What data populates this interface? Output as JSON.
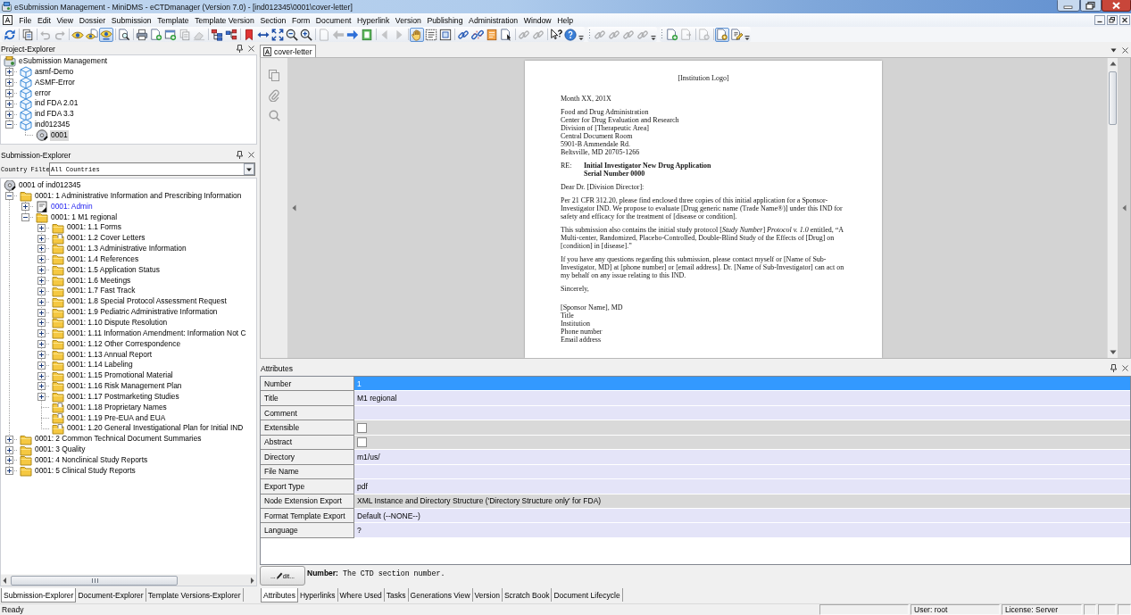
{
  "window": {
    "title": "eSubmission Management - MiniDMS - eCTDmanager (Version 7.0) - [ind012345\\0001\\cover-letter]"
  },
  "menu": [
    "File",
    "Edit",
    "View",
    "Dossier",
    "Submission",
    "Template",
    "Template Version",
    "Section",
    "Form",
    "Document",
    "Hyperlink",
    "Version",
    "Publishing",
    "Administration",
    "Window",
    "Help"
  ],
  "toolbars": [
    {
      "groups": [
        [
          {
            "pressed": false,
            "disabled": false
          }
        ],
        [
          {
            "pressed": false,
            "disabled": false
          }
        ],
        [
          {
            "pressed": false,
            "disabled": true
          },
          {
            "pressed": false,
            "disabled": true
          }
        ],
        [
          {
            "pressed": false,
            "disabled": false
          },
          {
            "pressed": false,
            "disabled": false
          },
          {
            "pressed": true,
            "disabled": false
          }
        ],
        [
          {
            "pressed": false,
            "disabled": false
          }
        ],
        [
          {
            "pressed": false,
            "disabled": false
          },
          {
            "pressed": false,
            "disabled": false
          },
          {
            "pressed": false,
            "disabled": false
          },
          {
            "pressed": false,
            "disabled": true
          },
          {
            "pressed": false,
            "disabled": true
          }
        ],
        [
          {
            "pressed": false,
            "disabled": false
          },
          {
            "pressed": false,
            "disabled": false
          }
        ],
        [
          {
            "pressed": false,
            "disabled": false
          },
          {
            "pressed": false,
            "disabled": false
          },
          {
            "pressed": false,
            "disabled": false
          },
          {
            "pressed": false,
            "disabled": false
          },
          {
            "pressed": false,
            "disabled": false
          }
        ],
        [
          {
            "pressed": false,
            "disabled": true
          },
          {
            "pressed": false,
            "disabled": true
          },
          {
            "pressed": false,
            "disabled": false
          },
          {
            "pressed": false,
            "disabled": false
          }
        ],
        [
          {
            "pressed": false,
            "disabled": true
          },
          {
            "pressed": false,
            "disabled": true
          }
        ],
        [
          {
            "pressed": true,
            "disabled": false
          },
          {
            "pressed": false,
            "disabled": false
          },
          {
            "pressed": false,
            "disabled": false
          }
        ],
        [
          {
            "pressed": false,
            "disabled": false
          },
          {
            "pressed": false,
            "disabled": false
          },
          {
            "pressed": false,
            "disabled": false
          },
          {
            "pressed": false,
            "disabled": false
          }
        ],
        [
          {
            "pressed": false,
            "disabled": true
          },
          {
            "pressed": false,
            "disabled": true
          }
        ],
        [
          {
            "pressed": false,
            "disabled": false
          },
          {
            "pressed": false,
            "disabled": false
          }
        ]
      ]
    },
    {
      "groups": [
        [
          {
            "pressed": false,
            "disabled": true
          },
          {
            "pressed": false,
            "disabled": true
          },
          {
            "pressed": false,
            "disabled": true
          },
          {
            "pressed": false,
            "disabled": true
          }
        ]
      ]
    },
    {
      "groups": [
        [
          {
            "pressed": false,
            "disabled": false
          },
          {
            "pressed": false,
            "disabled": true
          }
        ],
        [
          {
            "pressed": false,
            "disabled": true
          }
        ],
        [
          {
            "pressed": true,
            "disabled": false
          },
          {
            "pressed": false,
            "disabled": false
          }
        ]
      ]
    }
  ],
  "project_explorer": {
    "title": "Project-Explorer",
    "tree": [
      {
        "label": "eSubmission Management",
        "kind": "project",
        "selected": false,
        "children": [
          {
            "label": "asmf-Demo",
            "kind": "dossier",
            "expanded": false,
            "selected": false
          },
          {
            "label": "ASMF-Error",
            "kind": "dossier",
            "expanded": false,
            "selected": false
          },
          {
            "label": "error",
            "kind": "dossier",
            "expanded": false,
            "selected": false
          },
          {
            "label": "ind FDA 2.01",
            "kind": "dossier",
            "expanded": false,
            "selected": false
          },
          {
            "label": "ind FDA 3.3",
            "kind": "dossier",
            "expanded": false,
            "selected": false
          },
          {
            "label": "ind012345",
            "kind": "dossier",
            "expanded": true,
            "selected": false,
            "children": [
              {
                "label": "0001",
                "kind": "submission",
                "selected": true
              }
            ]
          }
        ]
      }
    ]
  },
  "submission_explorer": {
    "title": "Submission-Explorer",
    "filter": {
      "label": "Country Filte",
      "value": "All Countries"
    },
    "tree": [
      {
        "label": "0001 of ind012345",
        "kind": "submission",
        "selected": false,
        "children": [
          {
            "label": "0001: 1 Administrative Information and Prescribing Information",
            "kind": "folder",
            "expanded": true,
            "selected": false,
            "children": [
              {
                "label": "0001: Admin",
                "kind": "form",
                "expanded": false,
                "selected": false
              },
              {
                "label": "0001: 1 M1 regional",
                "kind": "folder",
                "expanded": true,
                "selected": false,
                "children": [
                  {
                    "label": "0001: 1.1 Forms",
                    "kind": "folder",
                    "expanded": false,
                    "selected": false
                  },
                  {
                    "label": "0001: 1.2 Cover Letters",
                    "kind": "document-folder",
                    "expanded": false,
                    "selected": false
                  },
                  {
                    "label": "0001: 1.3 Administrative Information",
                    "kind": "folder",
                    "expanded": false,
                    "selected": false
                  },
                  {
                    "label": "0001: 1.4 References",
                    "kind": "folder",
                    "expanded": false,
                    "selected": false
                  },
                  {
                    "label": "0001: 1.5 Application Status",
                    "kind": "folder",
                    "expanded": false,
                    "selected": false
                  },
                  {
                    "label": "0001: 1.6 Meetings",
                    "kind": "folder",
                    "expanded": false,
                    "selected": false
                  },
                  {
                    "label": "0001: 1.7 Fast Track",
                    "kind": "folder",
                    "expanded": false,
                    "selected": false
                  },
                  {
                    "label": "0001: 1.8 Special Protocol Assessment Request",
                    "kind": "folder",
                    "expanded": false,
                    "selected": false
                  },
                  {
                    "label": "0001: 1.9 Pediatric Administrative Information",
                    "kind": "folder",
                    "expanded": false,
                    "selected": false
                  },
                  {
                    "label": "0001: 1.10 Dispute Resolution",
                    "kind": "folder",
                    "expanded": false,
                    "selected": false
                  },
                  {
                    "label": "0001: 1.11 Information Amendment: Information Not C",
                    "kind": "folder",
                    "expanded": false,
                    "selected": false
                  },
                  {
                    "label": "0001: 1.12 Other Correspondence",
                    "kind": "folder",
                    "expanded": false,
                    "selected": false
                  },
                  {
                    "label": "0001: 1.13 Annual Report",
                    "kind": "folder",
                    "expanded": false,
                    "selected": false
                  },
                  {
                    "label": "0001: 1.14 Labeling",
                    "kind": "folder",
                    "expanded": false,
                    "selected": false
                  },
                  {
                    "label": "0001: 1.15 Promotional Material",
                    "kind": "folder",
                    "expanded": false,
                    "selected": false
                  },
                  {
                    "label": "0001: 1.16 Risk Management Plan",
                    "kind": "folder",
                    "expanded": false,
                    "selected": false
                  },
                  {
                    "label": "0001: 1.17 Postmarketing Studies",
                    "kind": "folder",
                    "expanded": false,
                    "selected": false
                  },
                  {
                    "label": "0001: 1.18 Proprietary Names",
                    "kind": "document-folder",
                    "selected": false
                  },
                  {
                    "label": "0001: 1.19 Pre-EUA and EUA",
                    "kind": "document-folder",
                    "selected": false
                  },
                  {
                    "label": "0001: 1.20 General Investigational Plan for Initial IND",
                    "kind": "document-folder",
                    "selected": false
                  }
                ]
              }
            ]
          },
          {
            "label": "0001: 2 Common Technical Document Summaries",
            "kind": "folder",
            "expanded": false,
            "selected": false
          },
          {
            "label": "0001: 3 Quality",
            "kind": "folder",
            "expanded": false,
            "selected": false
          },
          {
            "label": "0001: 4 Nonclinical Study Reports",
            "kind": "folder",
            "expanded": false,
            "selected": false
          },
          {
            "label": "0001: 5 Clinical Study Reports",
            "kind": "folder",
            "expanded": false,
            "selected": false
          }
        ]
      }
    ]
  },
  "left_tabs": [
    {
      "label": "Submission-Explorer",
      "selected": true
    },
    {
      "label": "Document-Explorer",
      "selected": false
    },
    {
      "label": "Template Versions-Explorer",
      "selected": false
    }
  ],
  "document": {
    "tabs": [
      {
        "label": "cover-letter",
        "selected": true
      }
    ],
    "page": {
      "logo": "[Institution Logo]",
      "date": "Month XX, 201X",
      "address": [
        "Food and Drug Administration",
        "Center for Drug Evaluation and Research",
        "Division of [Therapeutic Area]",
        "Central Document Room",
        "5901-B Ammendale Rd.",
        "Beltsville, MD  20705-1266"
      ],
      "re": {
        "label": "RE:",
        "lines": [
          "Initial Investigator New Drug Application",
          "Serial Number 0000"
        ]
      },
      "salutation": "Dear Dr. [Division Director]:",
      "paragraphs": [
        "Per 21 CFR 312.20, please find enclosed three copies of this initial application for a Sponsor-Investigator IND.  We propose to evaluate [Drug generic name (Trade Name®)] under this IND for safety and efficacy for the treatment of [disease or condition].",
        "This submission also contains the initial study protocol [*Study Number*] *Protocol v. 1.0* entitled, “A Multi-center, Randomized, Placebo-Controlled, Double-Blind Study of the Effects of [Drug] on [condition] in [disease].”",
        "If you have any questions regarding this submission, please contact myself or [Name of Sub-Investigator, MD] at [phone number] or [email address].  Dr. [Name of Sub-Investigator] can act on my behalf on any issue relating to this IND."
      ],
      "closing": "Sincerely,",
      "signature": [
        "[Sponsor Name], MD",
        "Title",
        "Institution",
        "Phone number",
        "Email address"
      ]
    }
  },
  "attributes": {
    "title": "Attributes",
    "rows": [
      {
        "label": "Number",
        "kind": "text",
        "value": "1",
        "selected": true,
        "readonly": false
      },
      {
        "label": "Title",
        "kind": "text",
        "value": "M1 regional",
        "selected": false,
        "readonly": false
      },
      {
        "label": "Comment",
        "kind": "text",
        "selected": false,
        "readonly": false
      },
      {
        "label": "Extensible",
        "kind": "checkbox",
        "checked": false,
        "selected": false,
        "readonly": true
      },
      {
        "label": "Abstract",
        "kind": "checkbox",
        "checked": false,
        "selected": false,
        "readonly": true
      },
      {
        "label": "Directory",
        "kind": "text",
        "value": "m1/us/",
        "selected": false,
        "readonly": false
      },
      {
        "label": "File Name",
        "kind": "text",
        "selected": false,
        "readonly": false
      },
      {
        "label": "Export Type",
        "kind": "text",
        "value": "pdf",
        "selected": false,
        "readonly": false
      },
      {
        "label": "Node Extension Export",
        "kind": "text",
        "value": "XML Instance and Directory Structure ('Directory Structure only' for FDA)",
        "selected": false,
        "readonly": true
      },
      {
        "label": "Format Template Export",
        "kind": "text",
        "value": "Default (--NONE--)",
        "selected": false,
        "readonly": false
      },
      {
        "label": "Language",
        "kind": "text",
        "value": "?",
        "selected": false,
        "readonly": false
      }
    ],
    "edit_button": {
      "prefix": "...",
      "label": "dit..."
    },
    "description": "**Number:** The CTD section number.",
    "tabs": [
      {
        "label": "Attributes",
        "selected": true
      },
      {
        "label": "Hyperlinks",
        "selected": false
      },
      {
        "label": "Where Used",
        "selected": false
      },
      {
        "label": "Tasks",
        "selected": false
      },
      {
        "label": "Generations View",
        "selected": false
      },
      {
        "label": "Version",
        "selected": false
      },
      {
        "label": "Scratch Book",
        "selected": false
      },
      {
        "label": "Document Lifecycle",
        "selected": false
      }
    ]
  },
  "status_bar": {
    "message": "Ready",
    "user": "User: root",
    "license": "License: Server"
  }
}
